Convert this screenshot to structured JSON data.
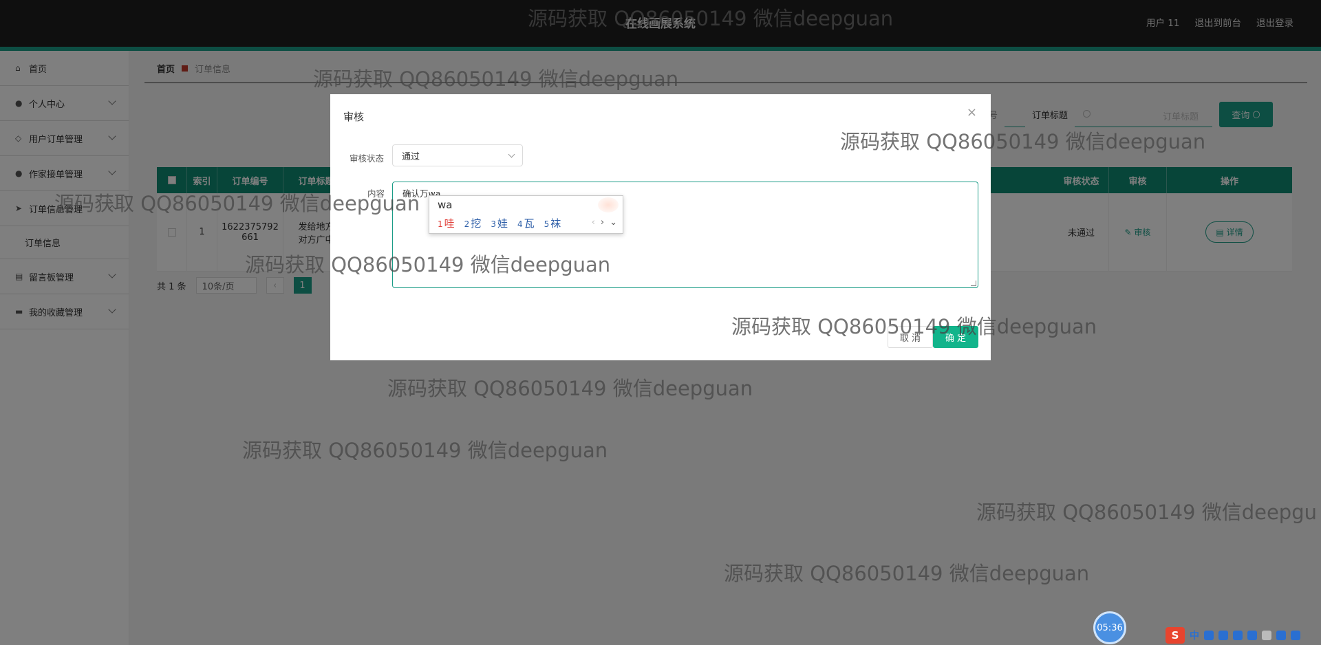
{
  "header": {
    "app_title": "在线画展系统",
    "user": "用户 11",
    "to_front": "退出到前台",
    "logout": "退出登录"
  },
  "sidebar": {
    "items": [
      {
        "label": "首页",
        "icon": "home-icon"
      },
      {
        "label": "个人中心",
        "icon": "user-icon"
      },
      {
        "label": "用户订单管理",
        "icon": "bell-icon"
      },
      {
        "label": "作家接单管理",
        "icon": "user-icon"
      },
      {
        "label": "订单信息管理",
        "icon": "send-icon"
      },
      {
        "label": "订单信息",
        "icon": ""
      },
      {
        "label": "留言板管理",
        "icon": "list-icon"
      },
      {
        "label": "我的收藏管理",
        "icon": "monitor-icon"
      }
    ]
  },
  "breadcrumb": {
    "home": "首页",
    "current": "订单信息"
  },
  "search": {
    "label1_partial": "订单编号",
    "label2": "订单标题",
    "placeholder": "订单标题",
    "query_button": "查询"
  },
  "table": {
    "headers": [
      "",
      "索引",
      "订单编号",
      "订单标题",
      "审核状态",
      "审核",
      "操作"
    ],
    "rows": [
      {
        "index": "1",
        "order_no": "1622375792661",
        "order_no_line1": "1622375792",
        "order_no_line2": "661",
        "title_partial_1": "发给地方",
        "title_partial_2": "对方广中",
        "status": "未通过",
        "audit": "审核",
        "action": "详情"
      }
    ]
  },
  "pager": {
    "total": "共 1 条",
    "size": "10条/页",
    "page": "1"
  },
  "dialog": {
    "title": "审核",
    "status_label": "审核状态",
    "status_value": "通过",
    "content_label": "内容",
    "content_value": "确认万wa",
    "cancel": "取 消",
    "confirm": "确 定"
  },
  "ime": {
    "input": "wa",
    "candidates": [
      {
        "n": "1",
        "c": "哇"
      },
      {
        "n": "2",
        "c": "挖"
      },
      {
        "n": "3",
        "c": "娃"
      },
      {
        "n": "4",
        "c": "瓦"
      },
      {
        "n": "5",
        "c": "袜"
      }
    ]
  },
  "watermark": "源码获取 QQ86050149 微信deepguan",
  "watermark_cut": "源码获取 QQ86050149 微信deepgu",
  "clock": "05:36",
  "tray": {
    "cn": "中"
  },
  "colors": {
    "accent": "#1b9c87",
    "header": "#1f1f1f",
    "ok_button": "#12b48b"
  }
}
